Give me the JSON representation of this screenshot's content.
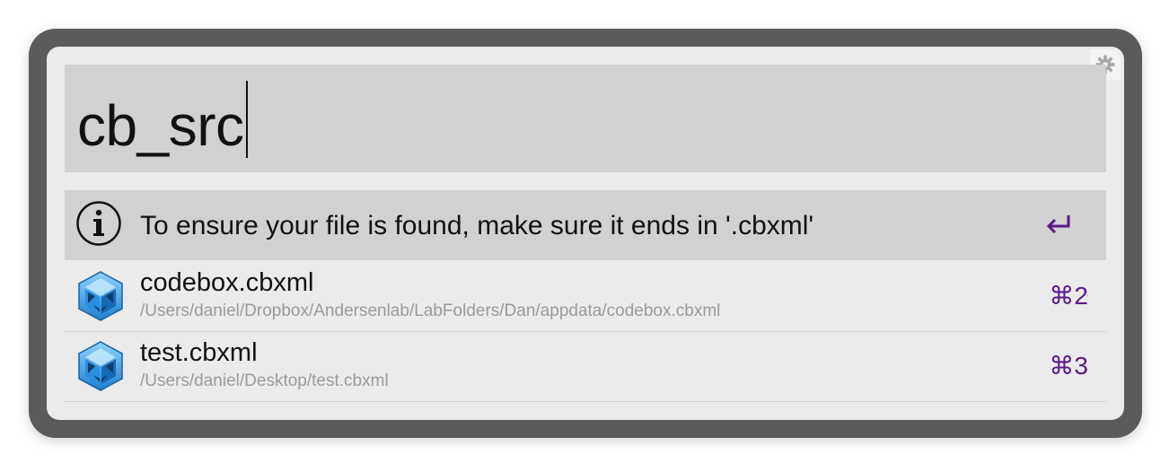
{
  "search": {
    "query": "cb_src"
  },
  "results": [
    {
      "type": "info",
      "icon": "info-icon",
      "title": "To ensure your file is found, make sure it ends in '.cbxml'",
      "action_icon": "return-icon",
      "selected": true
    },
    {
      "type": "file",
      "icon": "codebox-file-icon",
      "title": "codebox.cbxml",
      "subtitle": "/Users/daniel/Dropbox/Andersenlab/LabFolders/Dan/appdata/codebox.cbxml",
      "shortcut": "⌘2"
    },
    {
      "type": "file",
      "icon": "codebox-file-icon",
      "title": "test.cbxml",
      "subtitle": "/Users/daniel/Desktop/test.cbxml",
      "shortcut": "⌘3"
    }
  ],
  "colors": {
    "frame": "#5b5b5b",
    "panel": "#ebebeb",
    "search_background": "#d1d1d1",
    "selected_row": "#d1d1d1",
    "shortcut_text": "#5a1a8a",
    "subtitle_text": "#9a9a9a"
  },
  "settings": {
    "icon": "gear-icon"
  }
}
